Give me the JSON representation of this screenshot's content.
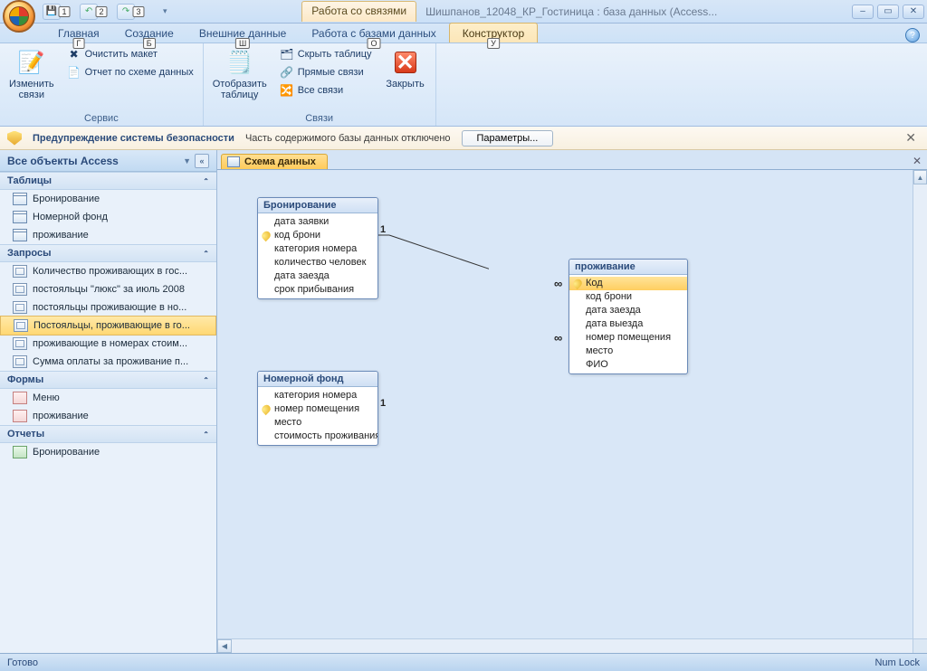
{
  "title": {
    "contextTab": "Работа со связями",
    "docTitle": "Шишпанов_12048_КР_Гостиница : база данных (Access..."
  },
  "qat": {
    "k1": "1",
    "k2": "2",
    "k3": "3"
  },
  "ribbonTabs": {
    "home": "Главная",
    "home_k": "Г",
    "create": "Создание",
    "create_k": "Б",
    "external": "Внешние данные",
    "external_k": "Ш",
    "dbtools": "Работа с базами данных",
    "dbtools_k": "О",
    "design": "Конструктор",
    "design_k": "У"
  },
  "ribbon": {
    "editRel": "Изменить\nсвязи",
    "clearLayout": "Очистить макет",
    "relReport": "Отчет по схеме данных",
    "group1": "Сервис",
    "showTable": "Отобразить\nтаблицу",
    "hideTable": "Скрыть таблицу",
    "directRel": "Прямые связи",
    "allRel": "Все связи",
    "group2": "Связи",
    "close": "Закрыть"
  },
  "security": {
    "title": "Предупреждение системы безопасности",
    "msg": "Часть содержимого базы данных отключено",
    "btn": "Параметры..."
  },
  "nav": {
    "header": "Все объекты Access",
    "sec_tables": "Таблицы",
    "tables": [
      "Бронирование",
      "Номерной фонд",
      "проживание"
    ],
    "sec_queries": "Запросы",
    "queries": [
      "Количество проживающих в гос...",
      "постояльцы \"люкс\" за июль 2008",
      "постояльцы проживающие в но...",
      "Постояльцы, проживающие в го...",
      "проживающие в номерах стоим...",
      "Сумма оплаты за проживание п..."
    ],
    "sec_forms": "Формы",
    "forms": [
      "Меню",
      "проживание"
    ],
    "sec_reports": "Отчеты",
    "reports": [
      "Бронирование"
    ]
  },
  "docTab": "Схема данных",
  "tables": {
    "t1": {
      "title": "Бронирование",
      "fields": [
        "дата заявки",
        "код брони",
        "категория номера",
        "количество человек",
        "дата заезда",
        "срок прибывания"
      ]
    },
    "t2": {
      "title": "Номерной фонд",
      "fields": [
        "категория номера",
        "номер помещения",
        "место",
        "стоимость проживания"
      ]
    },
    "t3": {
      "title": "проживание",
      "fields": [
        "Код",
        "код брони",
        "дата заезда",
        "дата выезда",
        "номер помещения",
        "место",
        "ФИО"
      ]
    }
  },
  "rel": {
    "one": "1",
    "many": "∞"
  },
  "status": {
    "ready": "Готово",
    "numlock": "Num Lock"
  }
}
